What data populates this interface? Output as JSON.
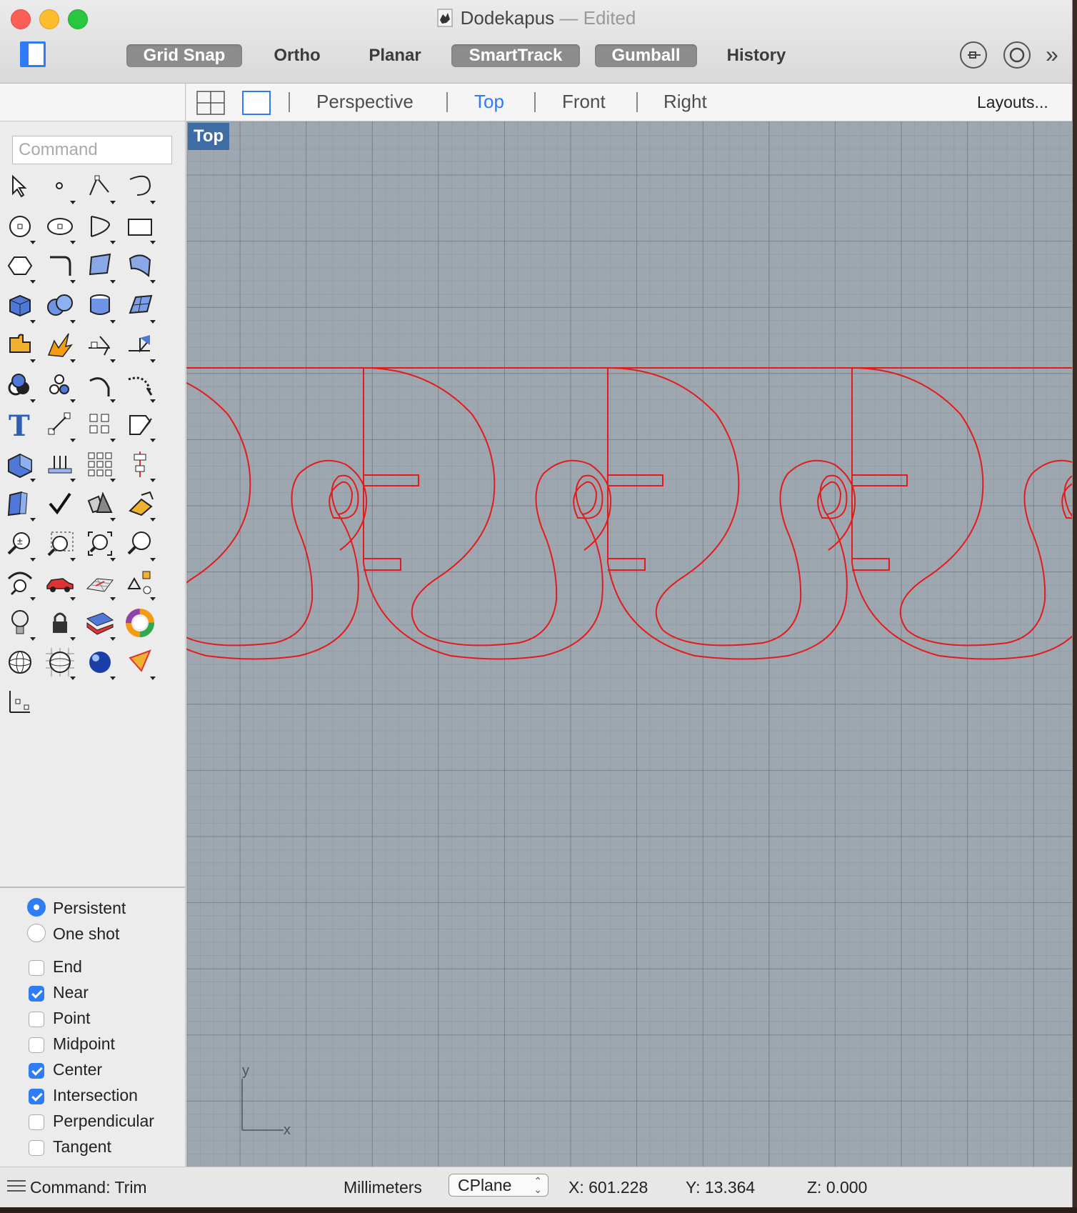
{
  "window": {
    "title": "Dodekapus",
    "title_suffix": "— Edited"
  },
  "toolbar": {
    "items": [
      {
        "label": "Grid Snap",
        "active": true
      },
      {
        "label": "Ortho",
        "active": false
      },
      {
        "label": "Planar",
        "active": false
      },
      {
        "label": "SmartTrack",
        "active": true
      },
      {
        "label": "Gumball",
        "active": true
      },
      {
        "label": "History",
        "active": false
      }
    ],
    "right_icons": [
      "osnap-icon",
      "record-icon",
      "overflow-chevron-icon"
    ],
    "overflow_glyph": "»"
  },
  "viewtabs": {
    "tabs": [
      "Perspective",
      "Top",
      "Front",
      "Right"
    ],
    "active": "Top",
    "layouts_label": "Layouts...",
    "active_color": "#2f7bf5"
  },
  "command": {
    "placeholder": "Command"
  },
  "tools": [
    "select-arrow-icon",
    "point-icon",
    "polyline-icon",
    "curve-icon",
    "circle-icon",
    "ellipse-icon",
    "arc-icon",
    "rectangle-icon",
    "polygon-icon",
    "fillet-curve-icon",
    "surface-corner-points-icon",
    "loft-surface-icon",
    "box-icon",
    "sphere-union-icon",
    "cylinder-icon",
    "patch-surface-icon",
    "puzzle-join-icon",
    "explode-icon",
    "trim-icon",
    "split-icon",
    "boolean-union-icon",
    "points-group-icon",
    "rotate-curve-icon",
    "blend-curve-icon",
    "text-icon",
    "scale-icon",
    "array-icon",
    "edit-points-icon",
    "extrude-box-icon",
    "project-icon",
    "grid-array-icon",
    "align-icon",
    "offset-surface-icon",
    "check-icon",
    "shaded-solids-icon",
    "sweep-icon",
    "zoom-extents-icon",
    "zoom-window-icon",
    "zoom-all-icon",
    "zoom-icon",
    "rotate-view-icon",
    "car-icon",
    "cplane-icon",
    "distance-icon",
    "light-bulb-icon",
    "lock-icon",
    "layer-icon",
    "color-wheel-icon",
    "sphere-wire-icon",
    "sphere-grid-icon",
    "material-ball-icon",
    "camera-icon",
    "gumball-axis-icon"
  ],
  "snaps": {
    "modes": [
      {
        "label": "Persistent",
        "selected": true
      },
      {
        "label": "One shot",
        "selected": false
      }
    ],
    "osnaps": [
      {
        "label": "End",
        "checked": false
      },
      {
        "label": "Near",
        "checked": true
      },
      {
        "label": "Point",
        "checked": false
      },
      {
        "label": "Midpoint",
        "checked": false
      },
      {
        "label": "Center",
        "checked": true
      },
      {
        "label": "Intersection",
        "checked": true
      },
      {
        "label": "Perpendicular",
        "checked": false
      },
      {
        "label": "Tangent",
        "checked": false
      }
    ]
  },
  "viewport": {
    "label": "Top",
    "curve_color": "#e31b1b",
    "grid_color": "#9ea6b0",
    "axis_y": "y",
    "axis_x": "x"
  },
  "status": {
    "command": "Command: Trim",
    "units": "Millimeters",
    "cplane": "CPlane",
    "x": "X: 601.228",
    "y": "Y: 13.364",
    "z": "Z: 0.000"
  }
}
